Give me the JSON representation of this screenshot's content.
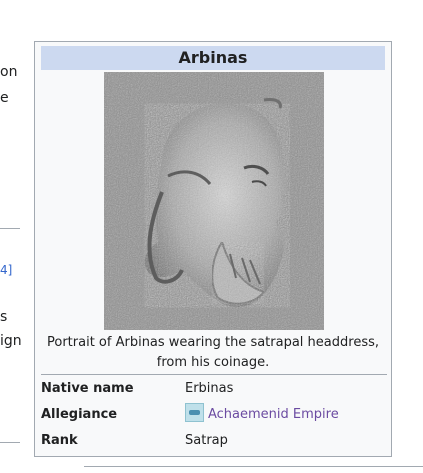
{
  "left_column": {
    "fragments": [
      "on",
      "e",
      "4]",
      "s",
      "ign"
    ]
  },
  "infobox": {
    "title": "Arbinas",
    "image_alt": "Portrait of Arbinas",
    "caption_line1": "Portrait of Arbinas wearing the satrapal headdress,",
    "caption_line2": "from his coinage.",
    "rows": [
      {
        "label": "Native name",
        "value": "Erbinas"
      },
      {
        "label": "Allegiance",
        "value": "Achaemenid Empire",
        "icon": "flag-icon"
      },
      {
        "label": "Rank",
        "value": "Satrap"
      }
    ]
  },
  "colors": {
    "title_bg": "#ccd9f0",
    "infobox_bg": "#f8f9fa",
    "border": "#a2a9b1",
    "visited_link": "#6b4ba1",
    "link": "#3366cc"
  }
}
